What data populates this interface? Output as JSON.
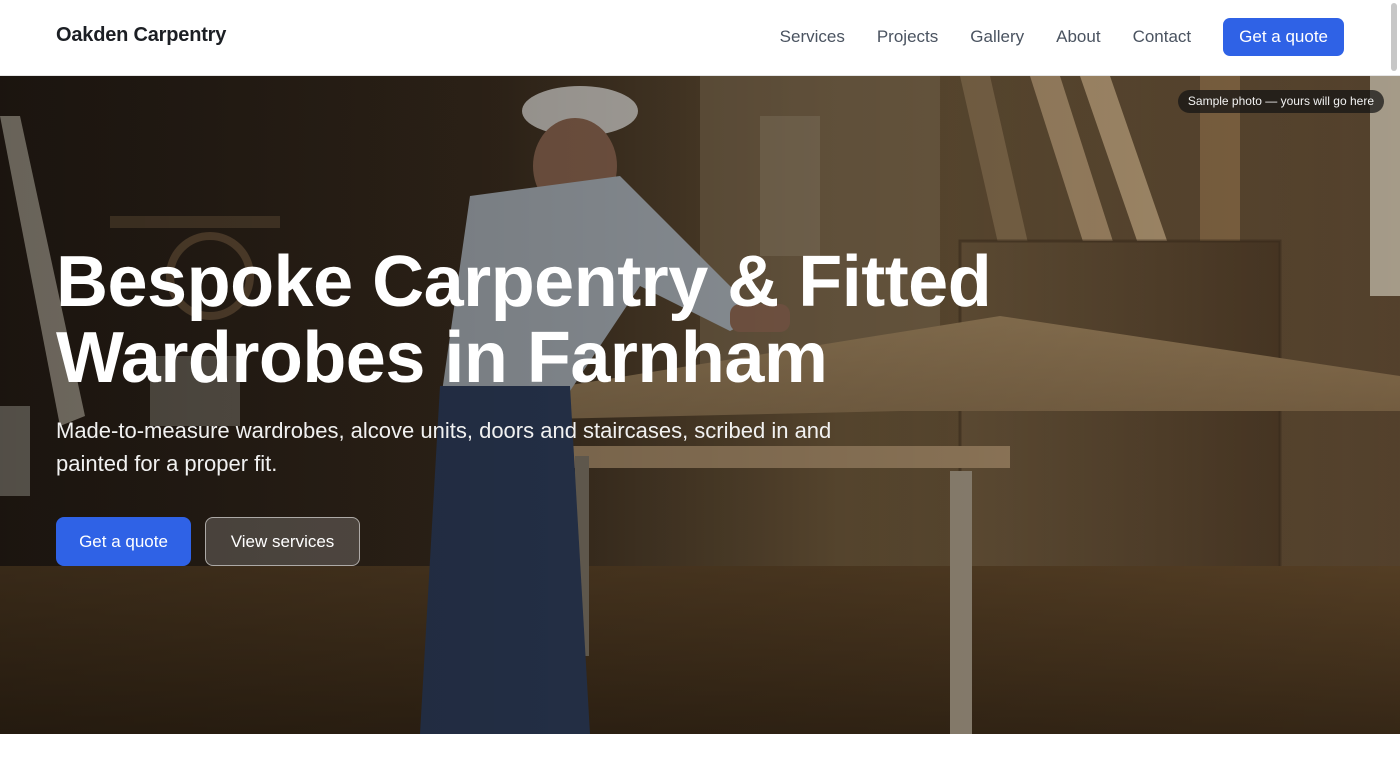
{
  "header": {
    "brand": "Oakden Carpentry",
    "nav": [
      "Services",
      "Projects",
      "Gallery",
      "About",
      "Contact"
    ],
    "cta_label": "Get a quote"
  },
  "hero": {
    "photo_credit": "Sample photo — yours will go here",
    "title_line1": "Bespoke Carpentry & Fitted",
    "title_line2": "Wardrobes in Farnham",
    "subtitle": "Made-to-measure wardrobes, alcove units, doors and staircases, scribed in and painted for a proper fit.",
    "primary_cta": "Get a quote",
    "secondary_cta": "View services"
  },
  "colors": {
    "accent": "#2f62e6",
    "heading": "#1c1f24",
    "nav_text": "#4a5360"
  }
}
